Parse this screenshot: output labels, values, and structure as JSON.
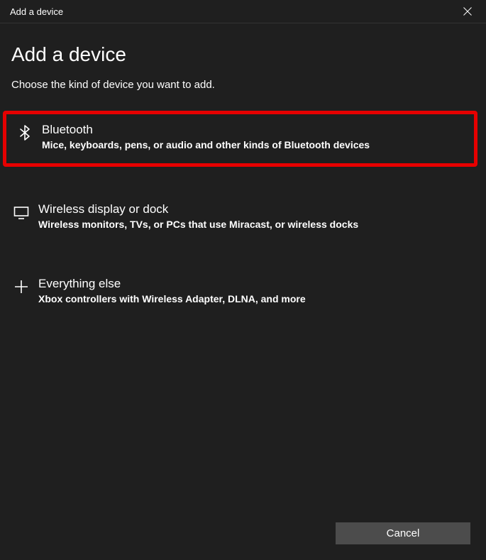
{
  "titlebar": {
    "title": "Add a device"
  },
  "header": {
    "heading": "Add a device",
    "subheading": "Choose the kind of device you want to add."
  },
  "options": {
    "bluetooth": {
      "title": "Bluetooth",
      "desc": "Mice, keyboards, pens, or audio and other kinds of Bluetooth devices",
      "icon": "bluetooth-icon",
      "highlighted": true
    },
    "wireless": {
      "title": "Wireless display or dock",
      "desc": "Wireless monitors, TVs, or PCs that use Miracast, or wireless docks",
      "icon": "display-icon",
      "highlighted": false
    },
    "other": {
      "title": "Everything else",
      "desc": "Xbox controllers with Wireless Adapter, DLNA, and more",
      "icon": "plus-icon",
      "highlighted": false
    }
  },
  "footer": {
    "cancel_label": "Cancel"
  }
}
